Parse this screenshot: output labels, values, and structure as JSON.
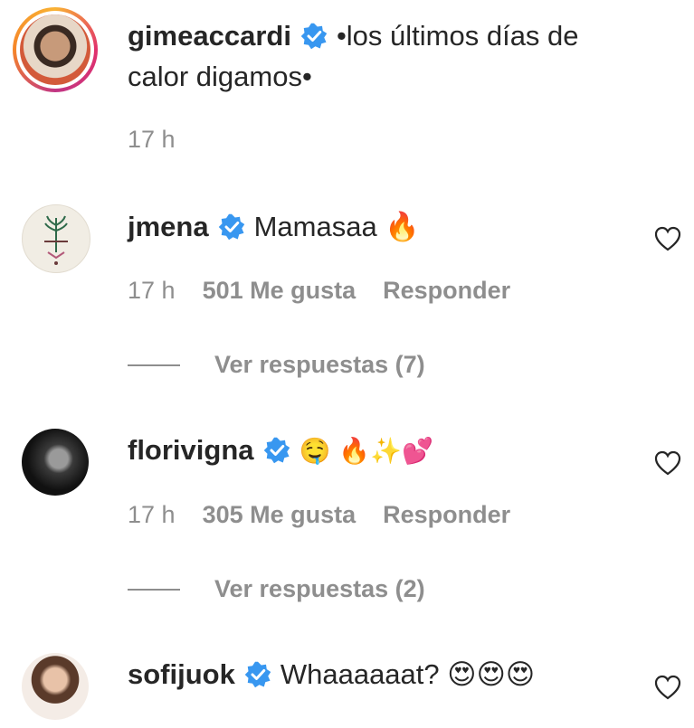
{
  "caption": {
    "username": "gimeaccardi",
    "text": "•los últimos días de",
    "text_line2": "calor digamos•",
    "time": "17 h"
  },
  "comments": [
    {
      "username": "jmena",
      "text": "Mamasaa 🔥",
      "time": "17 h",
      "likes": "501 Me gusta",
      "reply": "Responder",
      "view_replies": "Ver respuestas (7)"
    },
    {
      "username": "florivigna",
      "text": "🤤 🔥✨💕",
      "time": "17 h",
      "likes": "305 Me gusta",
      "reply": "Responder",
      "view_replies": "Ver respuestas (2)"
    },
    {
      "username": "sofijuok",
      "text": "Whaaaaaat? 😍😍😍"
    }
  ],
  "colors": {
    "verified": "#3897f0",
    "secondary_text": "#8e8e8e",
    "primary_text": "#262626"
  }
}
